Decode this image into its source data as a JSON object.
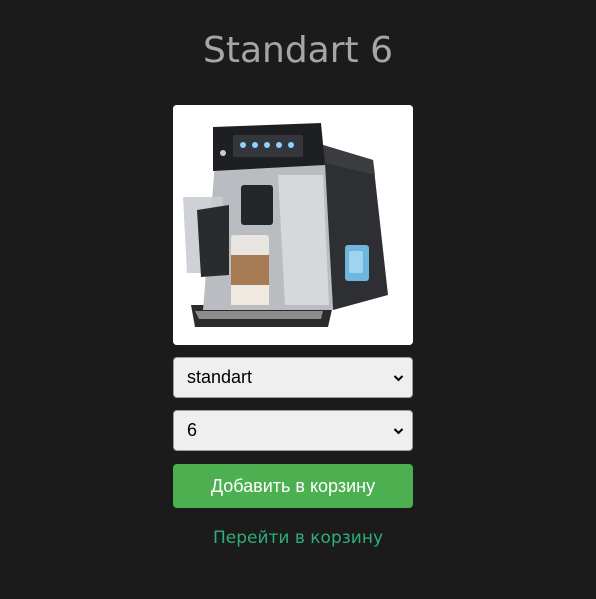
{
  "product": {
    "title": "Standart 6",
    "image_alt": "coffee-machine"
  },
  "options": {
    "type_selected": "standart",
    "size_selected": "6"
  },
  "actions": {
    "add_to_cart_label": "Добавить в корзину",
    "go_to_cart_label": "Перейти в корзину"
  },
  "colors": {
    "background": "#1b1b1b",
    "button": "#4caf50",
    "link": "#2fae7a",
    "title": "#a6a6a6"
  }
}
